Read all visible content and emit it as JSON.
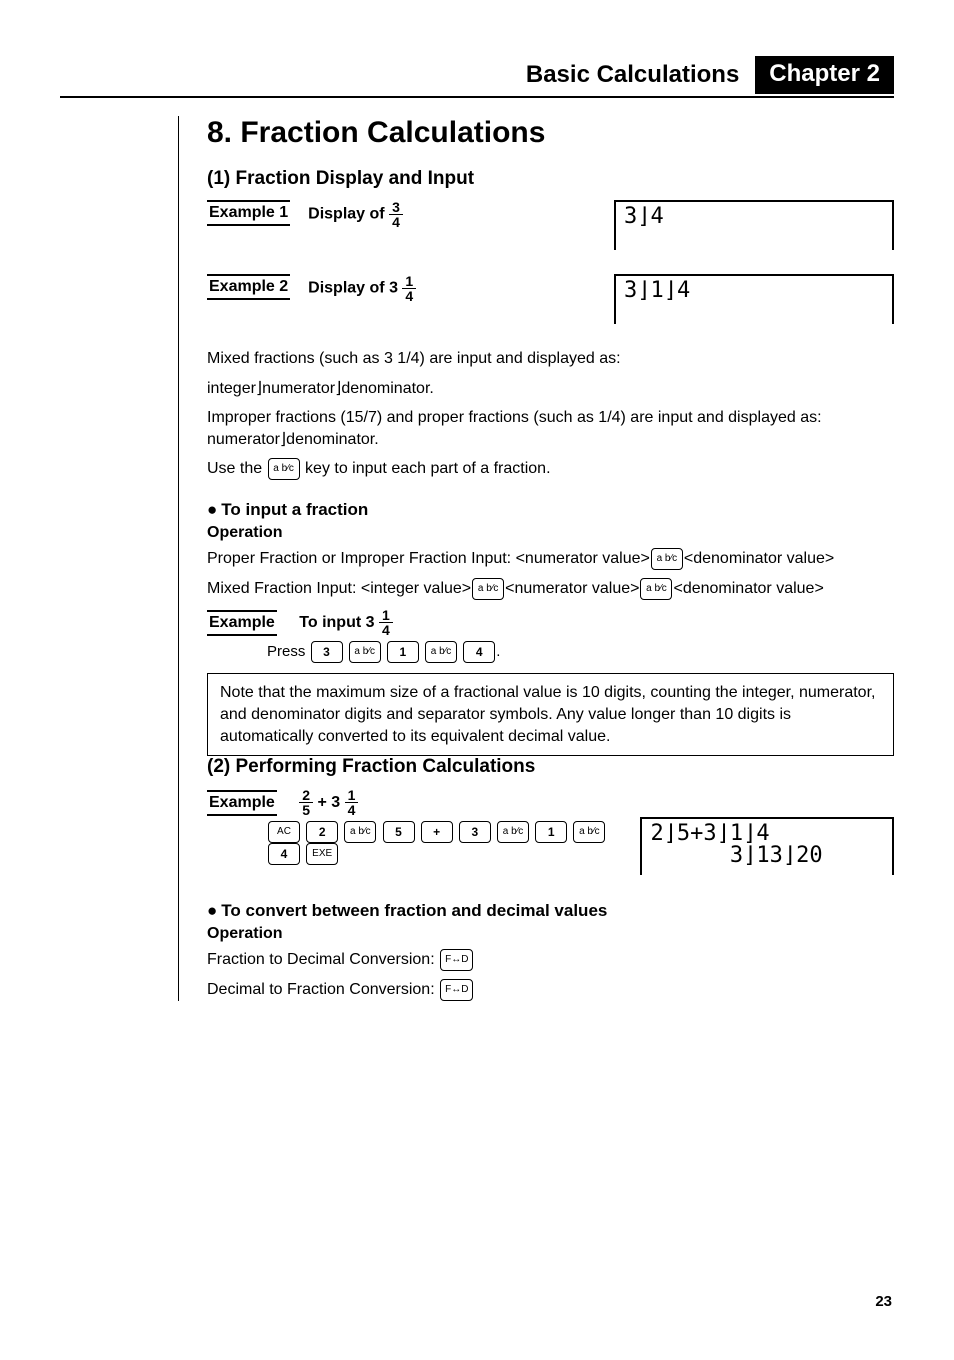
{
  "header": {
    "title": "Basic Calculations",
    "chapter": "Chapter 2"
  },
  "section_title": "8. Fraction Calculations",
  "s1": {
    "title": "(1) Fraction Display and Input",
    "ex1_label": "Example 1",
    "ex1_text": "Display of",
    "ex1_frac_num": "3",
    "ex1_frac_den": "4",
    "ex1_display": "3⌋4",
    "ex2_label": "Example 2",
    "ex2_text": "Display of 3",
    "ex2_frac_num": "1",
    "ex2_frac_den": "4",
    "ex2_display": "3⌋1⌋4",
    "p1": "Mixed fractions (such as 3 1/4) are input and displayed as:",
    "p2": "integer⌋numerator⌋denominator.",
    "p3": "Improper fractions (15/7) and proper fractions (such as 1/4) are input and displayed as: numerator⌋denominator.",
    "p4a": "Use the ",
    "p4b": " key to input each part of a fraction.",
    "bullet1": "To input a fraction",
    "op_hd": "Operation",
    "op1a": "Proper Fraction or Improper Fraction Input: <numerator value>",
    "op1b": "<denominator value>",
    "op2a": "Mixed Fraction Input: <integer value>",
    "op2b": "<numerator value>",
    "op2c": "<denominator value>",
    "ex3_label": "Example",
    "ex3_text": "To input 3",
    "ex3_frac_num": "1",
    "ex3_frac_den": "4",
    "press_label": "Press ",
    "press_end": ".",
    "note": "Note that the maximum size of a fractional value is 10 digits, counting the integer, numerator, and denominator digits and separator symbols. Any value longer than 10 digits is automatically converted to its equivalent decimal value."
  },
  "s2": {
    "title": "(2) Performing Fraction Calculations",
    "ex_label": "Example",
    "term1_num": "2",
    "term1_den": "5",
    "plus": " + 3",
    "term2_num": "1",
    "term2_den": "4",
    "display": "2⌋5+3⌋1⌋4\n      3⌋13⌋20",
    "bullet2": "To convert between fraction and decimal values",
    "op_hd": "Operation",
    "conv1": "Fraction to Decimal Conversion: ",
    "conv2": "Decimal to Fraction Conversion: "
  },
  "keys": {
    "abc": "a b⁄c",
    "k3": "3",
    "k1": "1",
    "k4": "4",
    "ac": "AC",
    "k2": "2",
    "k5": "5",
    "plus": "+",
    "exe": "EXE",
    "fd": "F↔D"
  },
  "page_number": "23"
}
